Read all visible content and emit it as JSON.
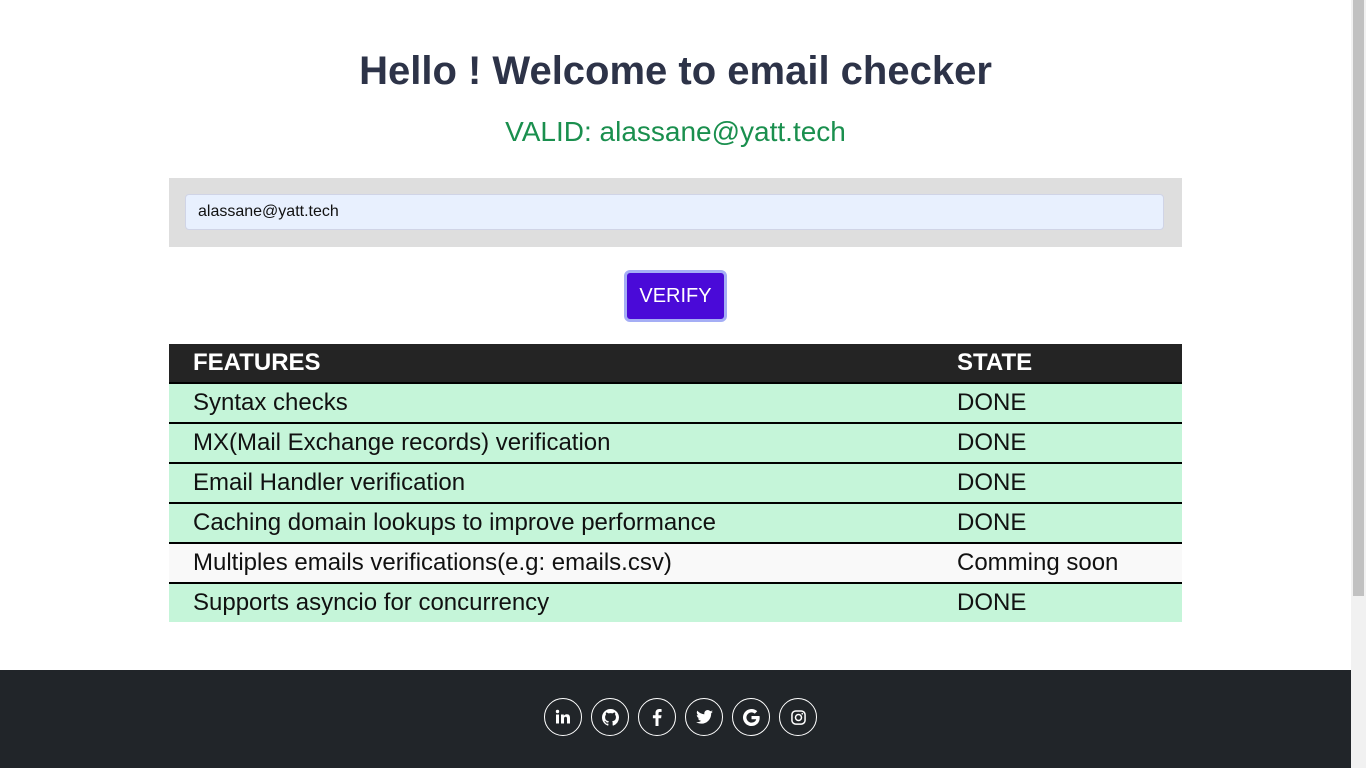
{
  "header": {
    "title": "Hello ! Welcome to email checker",
    "status": "VALID: alassane@yatt.tech",
    "status_color": "#1a8f4e"
  },
  "form": {
    "email_value": "alassane@yatt.tech",
    "verify_label": "VERIFY",
    "button_color": "#4a0ad8"
  },
  "table": {
    "headers": [
      "FEATURES",
      "STATE"
    ],
    "rows": [
      {
        "feature": "Syntax checks",
        "state": "DONE"
      },
      {
        "feature": "MX(Mail Exchange records) verification",
        "state": "DONE"
      },
      {
        "feature": "Email Handler verification",
        "state": "DONE"
      },
      {
        "feature": "Caching domain lookups to improve performance",
        "state": "DONE"
      },
      {
        "feature": "Multiples emails verifications(e.g: emails.csv)",
        "state": "Comming soon"
      },
      {
        "feature": "Supports asyncio for concurrency",
        "state": "DONE"
      }
    ],
    "done_color": "#c5f5d9"
  },
  "footer": {
    "social_icons": [
      "linkedin-icon",
      "github-icon",
      "facebook-icon",
      "twitter-icon",
      "google-icon",
      "instagram-icon"
    ]
  }
}
